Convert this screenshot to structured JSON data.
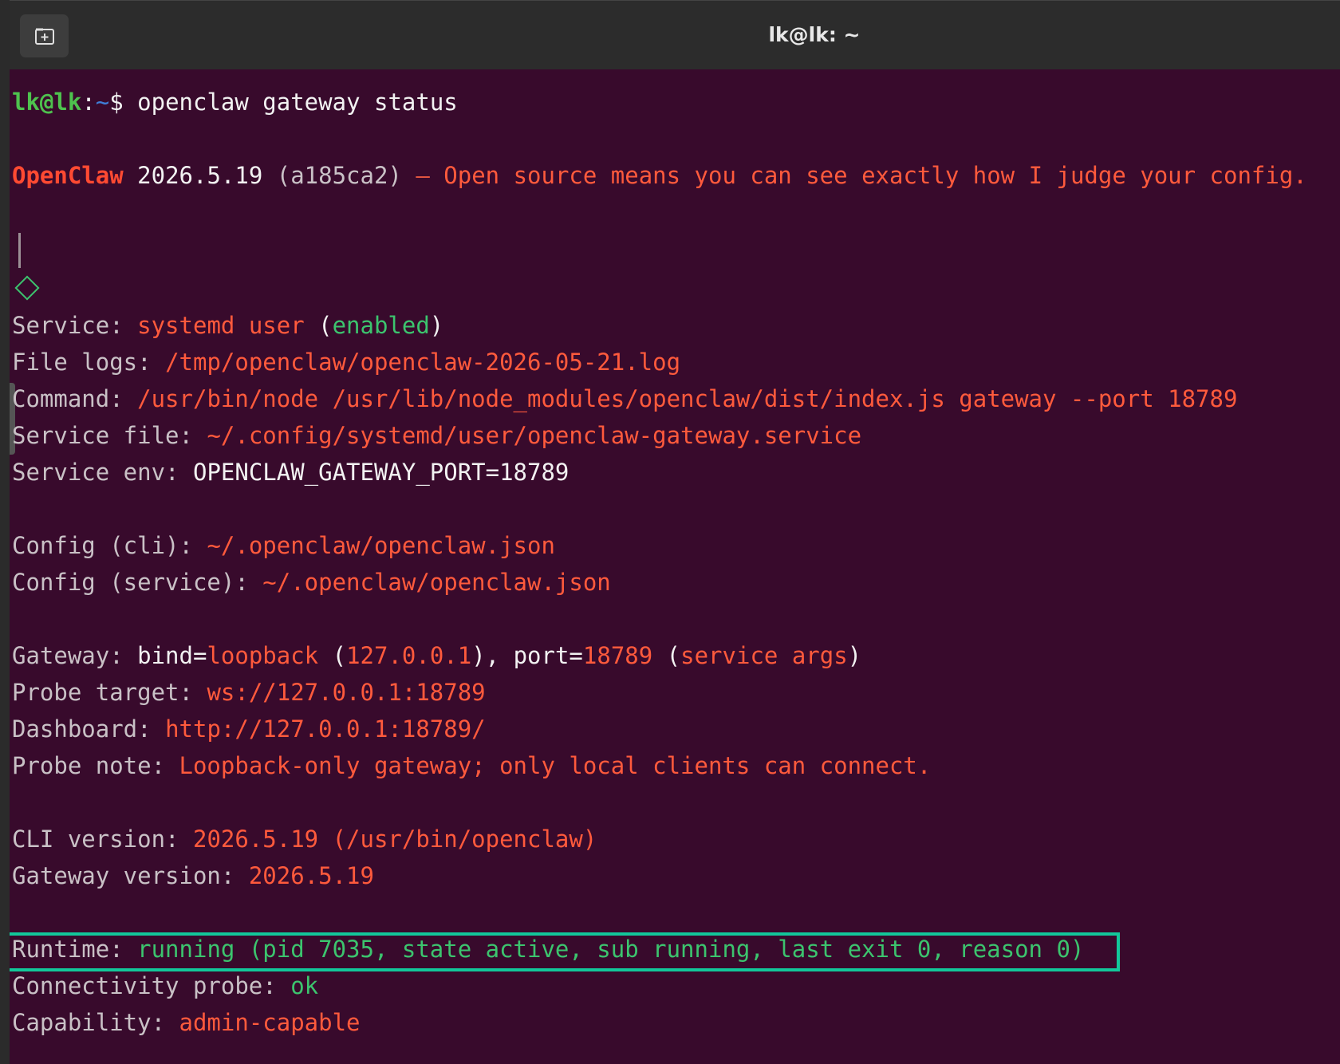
{
  "window": {
    "title": "lk@lk: ~",
    "new_tab_icon": "new-tab-icon"
  },
  "prompt": {
    "user_host": "lk@lk",
    "colon": ":",
    "path": "~",
    "dollar": "$ ",
    "command": "openclaw gateway status"
  },
  "banner": {
    "brand": "OpenClaw",
    "version": " 2026.5.19 ",
    "commit": "(a185ca2)",
    "dash": " — ",
    "tagline": "Open source means you can see exactly how I judge your config."
  },
  "service": {
    "label": "Service: ",
    "value": "systemd user",
    "paren_open": " (",
    "status": "enabled",
    "paren_close": ")"
  },
  "file_logs": {
    "label": "File logs: ",
    "value": "/tmp/openclaw/openclaw-2026-05-21.log"
  },
  "command_line": {
    "label": "Command: ",
    "value": "/usr/bin/node /usr/lib/node_modules/openclaw/dist/index.js gateway --port 18789"
  },
  "service_file": {
    "label": "Service file: ",
    "value": "~/.config/systemd/user/openclaw-gateway.service"
  },
  "service_env": {
    "label": "Service env: ",
    "value": "OPENCLAW_GATEWAY_PORT=18789"
  },
  "config_cli": {
    "label": "Config (cli): ",
    "value": "~/.openclaw/openclaw.json"
  },
  "config_service": {
    "label": "Config (service): ",
    "value": "~/.openclaw/openclaw.json"
  },
  "gateway": {
    "label": "Gateway: ",
    "bind_key": "bind=",
    "bind_value": "loopback",
    "ip_open": " (",
    "ip": "127.0.0.1",
    "ip_close": "), ",
    "port_key": "port=",
    "port_value": "18789",
    "args_open": " (",
    "args": "service args",
    "args_close": ")"
  },
  "probe_target": {
    "label": "Probe target: ",
    "value": "ws://127.0.0.1:18789"
  },
  "dashboard": {
    "label": "Dashboard: ",
    "value": "http://127.0.0.1:18789/"
  },
  "probe_note": {
    "label": "Probe note: ",
    "value": "Loopback-only gateway; only local clients can connect."
  },
  "cli_version": {
    "label": "CLI version: ",
    "value": "2026.5.19 (/usr/bin/openclaw)"
  },
  "gateway_version": {
    "label": "Gateway version: ",
    "value": "2026.5.19"
  },
  "runtime": {
    "label": "Runtime: ",
    "value": "running (pid 7035, state active, sub running, last exit 0, reason 0)"
  },
  "connectivity": {
    "label": "Connectivity probe: ",
    "value": "ok"
  },
  "capability": {
    "label": "Capability: ",
    "value": "admin-capable"
  },
  "colors": {
    "background": "#380a2c",
    "prompt_green": "#4ec24e",
    "accent_orange": "#ff5a3c",
    "highlight_box": "#12c79a"
  }
}
